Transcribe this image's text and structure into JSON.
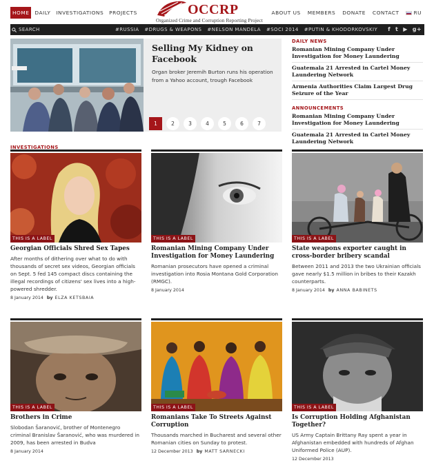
{
  "nav": {
    "left": [
      "HOME",
      "DAILY",
      "INVESTIGATIONS",
      "PROJECTS"
    ],
    "right": [
      "ABOUT US",
      "MEMBERS",
      "DONATE",
      "CONTACT"
    ],
    "lang": "RU"
  },
  "logo": {
    "word": "OCCRP",
    "subtitle": "Organized Crime and Corruption Reporting Project"
  },
  "bar": {
    "search": "SEARCH",
    "tags": [
      "#RUSSIA",
      "#DRUGS & WEAPONS",
      "#NELSON MANDELA",
      "#SOCI 2014",
      "#PUTIN & KHODORKOVSKIY"
    ],
    "socials": [
      "f",
      "t",
      "▶",
      "g+"
    ]
  },
  "featured": {
    "title": "Selling My Kidney on Facebook",
    "desc": "Organ broker Jeremih Burton runs his operation from a Yahoo account, trough Facebook",
    "pages": [
      "1",
      "2",
      "3",
      "4",
      "5",
      "6",
      "7"
    ],
    "active_page": "1"
  },
  "sidebar": {
    "daily_label": "DAILY NEWS",
    "daily": [
      "Romanian Mining Company Under Investigation for Money Laundering",
      "Guatemala 21 Arrested in Cartel Money Laundering Network",
      "Armenia Authorities Claim Largest Drug Seizure of the Year"
    ],
    "ann_label": "ANNOUNCEMENTS",
    "announcements": [
      "Romanian Mining Company Under Investigation for Money Laundering",
      "Guatemala 21 Arrested in Cartel Money Laundering Network"
    ]
  },
  "investigations": {
    "label": "INVESTIGATIONS",
    "cards": [
      {
        "badge": "THIS IS A LABEL",
        "title": "Georgian Officials Shred Sex Tapes",
        "desc": "After months of dithering over what to do with thousands of secret sex videos, Georgian officials on Sept. 5 fed 145 compact discs containing the illegal recordings of citizens' sex lives into a high-powered shredder.",
        "date": "8 January 2014",
        "by": "by",
        "author": "ELZA KETSBAIA"
      },
      {
        "badge": "THIS IS A LABEL",
        "title": "Romanian Mining Company Under Investigation for Money Laundering",
        "desc": "Romanian prosecutors have opened a criminal investigation into Rosia Montana Gold Corporation (RMGC).",
        "date": "8 January 2014",
        "by": "",
        "author": ""
      },
      {
        "badge": "THIS IS A LABEL",
        "title": "State weapons exporter caught in cross-border bribery scandal",
        "desc": "Between 2011 and 2013 the two Ukrainian officials gave nearly $1.5 million in bribes to their Kazakh counterparts.",
        "date": "8 January 2014",
        "by": "by",
        "author": "ANNA BABINETS"
      },
      {
        "badge": "THIS IS A LABEL",
        "title": "Brothers in Crime",
        "desc": "Slobodan Šaranović, brother of Montenegro criminal Branislav Šaranović, who was murdered in 2009, has been arrested in Budva",
        "date": "8 January 2014",
        "by": "",
        "author": ""
      },
      {
        "badge": "THIS IS A LABEL",
        "title": "Romanians Take To Streets Against Corruption",
        "desc": "Thousands marched in Bucharest and several other Romanian cities on Sunday to protest.",
        "date": "12 December 2013",
        "by": "by",
        "author": "MATT SARNECKI"
      },
      {
        "badge": "THIS IS A LABEL",
        "title": "Is Corruption Holding Afghanistan Together?",
        "desc": "US Army Captain Brittany Ray spent a year in Afghanistan embedded with hundreds of Afghan Uniformed Police (AUP).",
        "date": "12 December 2013",
        "by": "",
        "author": ""
      }
    ]
  },
  "colors": {
    "accent": "#a5161a",
    "dark": "#1f1f1f"
  }
}
